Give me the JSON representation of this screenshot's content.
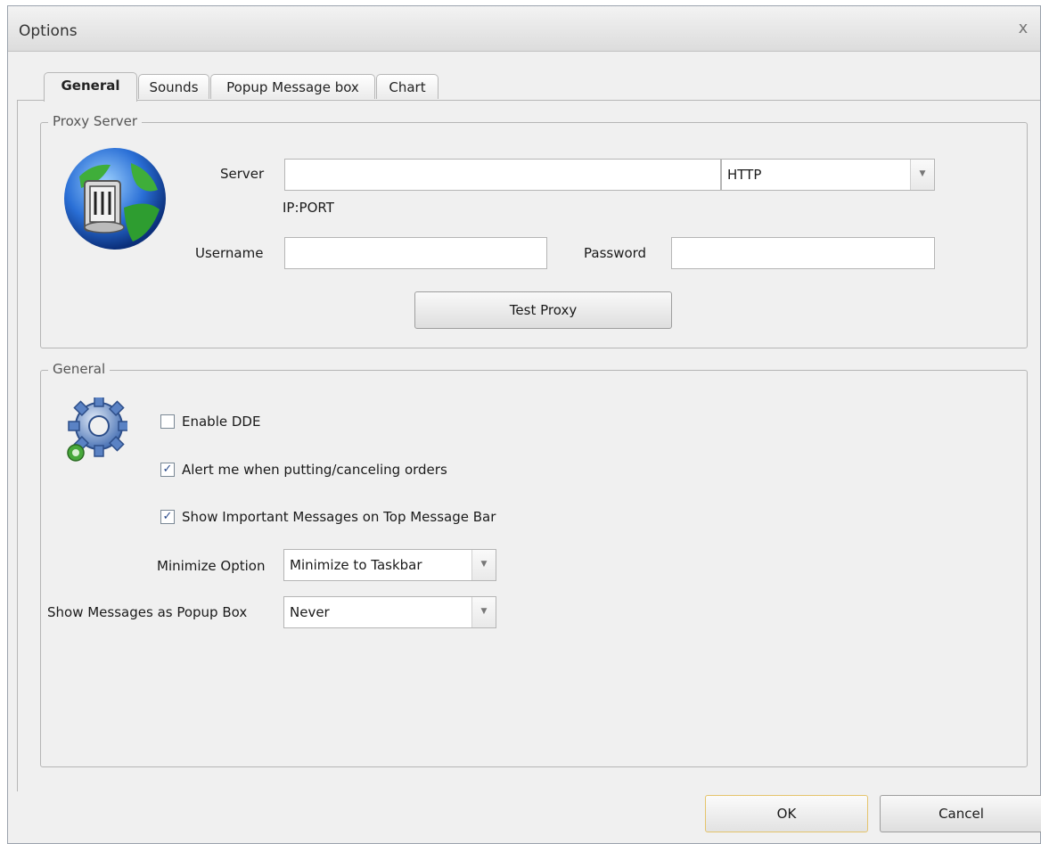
{
  "window": {
    "title": "Options",
    "close_glyph": "x"
  },
  "tabs": [
    {
      "label": "General",
      "active": true
    },
    {
      "label": "Sounds",
      "active": false
    },
    {
      "label": "Popup Message box",
      "active": false
    },
    {
      "label": "Chart",
      "active": false
    }
  ],
  "proxy": {
    "group_label": "Proxy Server",
    "icon": "globe-network-icon",
    "server_label": "Server",
    "server_value": "",
    "server_hint": "IP:PORT",
    "protocol_value": "HTTP",
    "username_label": "Username",
    "username_value": "",
    "password_label": "Password",
    "password_value": "",
    "test_button": "Test Proxy"
  },
  "general": {
    "group_label": "General",
    "icon": "gears-icon",
    "enable_dde": {
      "label": "Enable DDE",
      "checked": false
    },
    "alert_orders": {
      "label": "Alert me when putting/canceling orders",
      "checked": true
    },
    "show_messages": {
      "label": "Show Important Messages on Top Message Bar",
      "checked": true
    },
    "minimize_label": "Minimize Option",
    "minimize_value": "Minimize to Taskbar",
    "popup_label": "Show Messages as Popup Box",
    "popup_value": "Never"
  },
  "footer": {
    "ok": "OK",
    "cancel": "Cancel"
  },
  "colors": {
    "check": "#2a4a8a",
    "default_button_border": "#e5c46c"
  }
}
